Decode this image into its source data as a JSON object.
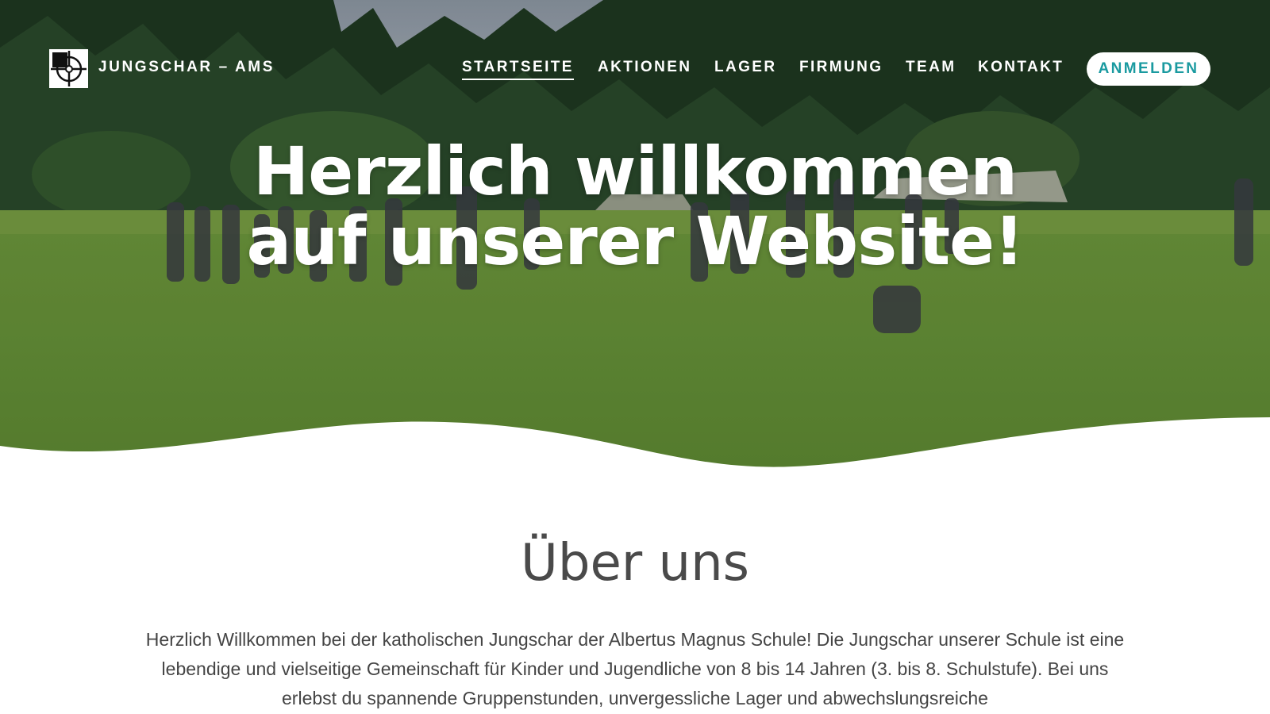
{
  "nav": {
    "brand": "JUNGSCHAR – AMS",
    "items": [
      {
        "label": "STARTSEITE",
        "active": true
      },
      {
        "label": "AKTIONEN",
        "active": false
      },
      {
        "label": "LAGER",
        "active": false
      },
      {
        "label": "FIRMUNG",
        "active": false
      },
      {
        "label": "TEAM",
        "active": false
      },
      {
        "label": "KONTAKT",
        "active": false
      }
    ],
    "cta_label": "ANMELDEN"
  },
  "hero": {
    "title": "Herzlich willkommen auf unserer Website!"
  },
  "about": {
    "title": "Über uns",
    "text": "Herzlich Willkommen bei der katholischen Jungschar der Albertus Magnus Schule! Die Jungschar unserer Schule ist eine lebendige und vielseitige Gemeinschaft für Kinder und Jugendliche von 8 bis 14 Jahren (3. bis 8. Schulstufe). Bei uns erlebst du spannende Gruppenstunden, unvergessliche Lager und abwechslungsreiche"
  },
  "colors": {
    "accent": "#1a9aa0",
    "text_dark": "#444444",
    "heading": "#4a4a4a",
    "white": "#ffffff"
  },
  "icons": {
    "logo": "crosshair-logo-icon"
  }
}
